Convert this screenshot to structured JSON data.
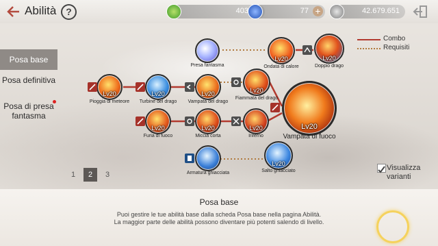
{
  "header": {
    "title": "Abilità",
    "help": "?",
    "currencies": [
      {
        "name": "green-gem",
        "value": "403",
        "color": "#6fb63a"
      },
      {
        "name": "blue-gem",
        "value": "77",
        "color": "#2d67c9"
      },
      {
        "name": "silver-coin",
        "value": "42.679.651",
        "color": "#9b9b9b"
      }
    ]
  },
  "tabs": [
    {
      "label": "Posa base",
      "active": true
    },
    {
      "label": "Posa definitiva"
    },
    {
      "label": "Posa di presa fantasma",
      "notification": true
    }
  ],
  "legend": {
    "combo": "Combo",
    "requirements": "Requisiti"
  },
  "skills": [
    {
      "id": "presa-fantasma",
      "name": "Presa fantasma",
      "level": "",
      "color": "#6b7fe0"
    },
    {
      "id": "ondata-calore",
      "name": "Ondata di calore",
      "level": "Lv20",
      "color": "#e0531e"
    },
    {
      "id": "doppio-drago",
      "name": "Doppio drago",
      "level": "Lv20",
      "color": "#d14a1f"
    },
    {
      "id": "pioggia-meteore",
      "name": "Pioggia di meteore",
      "level": "Lv20",
      "color": "#ee6a1a"
    },
    {
      "id": "turbine-drago",
      "name": "Turbine del drago",
      "level": "Lv20",
      "color": "#2f7fd6"
    },
    {
      "id": "vampata-drago",
      "name": "Vampata del drago",
      "level": "Lv20",
      "color": "#ea6b1c"
    },
    {
      "id": "fiammata-drago",
      "name": "Fiammata del drago",
      "level": "Lv20",
      "color": "#e04e1a"
    },
    {
      "id": "furia-fuoco",
      "name": "Furia di fuoco",
      "level": "Lv20",
      "color": "#e3581c"
    },
    {
      "id": "miccia-corta",
      "name": "Miccia corta",
      "level": "Lv20",
      "color": "#dd4b1a"
    },
    {
      "id": "inferno",
      "name": "Inferno",
      "level": "Lv20",
      "color": "#d44320"
    },
    {
      "id": "vampata-fuoco",
      "name": "Vampata di fuoco",
      "level": "Lv20",
      "color": "#f07a1c"
    },
    {
      "id": "armatura-ghiacciata",
      "name": "Armatura ghiacciata",
      "level": "",
      "color": "#3a7fd8"
    },
    {
      "id": "salto-ghiacciato",
      "name": "Salto ghiacciato",
      "level": "Lv20",
      "color": "#3b86e0"
    }
  ],
  "pages": [
    "1",
    "2",
    "3"
  ],
  "active_page": "2",
  "toggle": {
    "label": "Visualizza varianti",
    "checked": true
  },
  "panel": {
    "title": "Posa base",
    "line1": "Puoi gestire le tue abilità base dalla scheda Posa base nella pagina Abilità.",
    "line2": "La maggior parte delle abilità possono diventare più potenti salendo di livello."
  }
}
